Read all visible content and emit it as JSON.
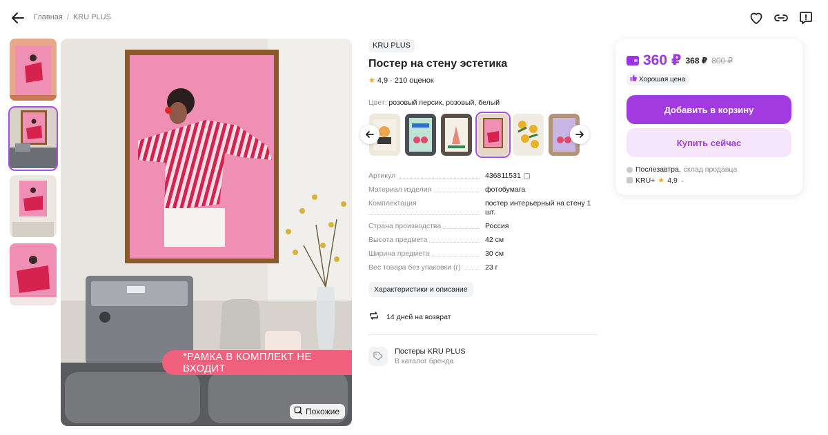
{
  "breadcrumb": {
    "home": "Главная",
    "separator": "/",
    "brand": "KRU PLUS"
  },
  "top_actions": [
    "heart-icon",
    "link-icon",
    "report-icon"
  ],
  "gallery": {
    "frame_note": "*РАМКА В КОМПЛЕКТ НЕ ВХОДИТ",
    "similar_label": "Похожие",
    "thumbnail_count": 4,
    "active_thumbnail": 2
  },
  "product": {
    "brand": "KRU PLUS",
    "title": "Постер на стену эстетика",
    "rating": "4,9",
    "reviews": "210 оценок",
    "rating_separator": "·",
    "color_label": "Цвет:",
    "color_value": "розовый персик, розовый, белый",
    "variant_count": 6,
    "active_variant": 4
  },
  "specs": [
    {
      "key": "Артикул",
      "value": "436811531"
    },
    {
      "key": "Материал изделия",
      "value": "фотобумага"
    },
    {
      "key": "Комплектация",
      "value": "постер интерьерный на стену 1 шт."
    },
    {
      "key": "Страна производства",
      "value": "Россия"
    },
    {
      "key": "Высота предмета",
      "value": "42 см"
    },
    {
      "key": "Ширина предмета",
      "value": "30 см"
    },
    {
      "key": "Вес товара без упаковки (г)",
      "value": "23 г"
    }
  ],
  "description_chip": "Характеристики и описание",
  "return_policy": "14 дней на возврат",
  "catalog": {
    "title": "Постеры KRU PLUS",
    "subtitle": "В каталог бренда"
  },
  "buy": {
    "price_card": "360 ₽",
    "price_regular": "368 ₽",
    "price_old": "800 ₽",
    "good_price_label": "Хорошая цена",
    "add_to_cart": "Добавить в корзину",
    "buy_now": "Купить сейчас",
    "delivery_when": "Послезавтра,",
    "delivery_from": "склад продавца",
    "seller_name": "KRU+",
    "seller_rating": "4,9"
  },
  "colors": {
    "accent": "#a13be0",
    "accent_light": "#f5e6fc",
    "star": "#f5a623",
    "poster_pink": "#ef8fb3"
  }
}
